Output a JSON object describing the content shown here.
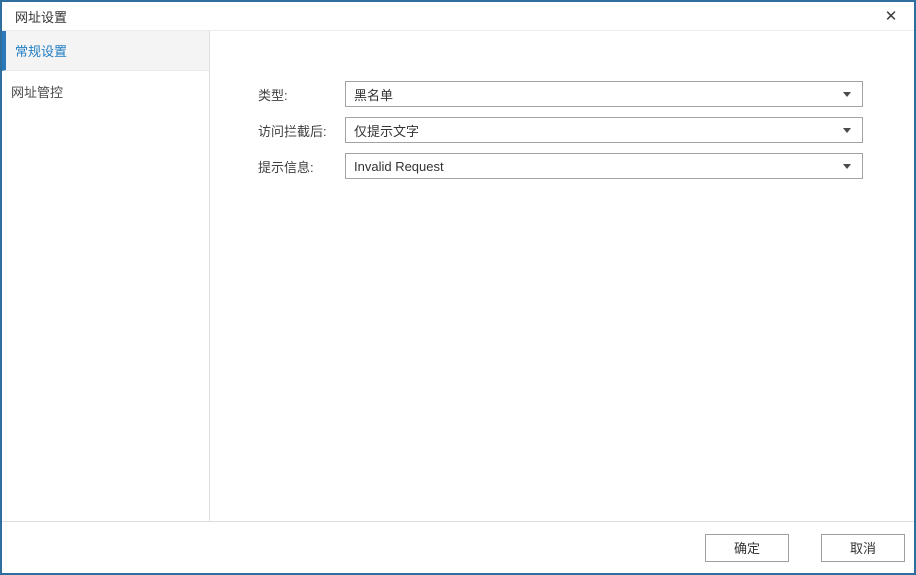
{
  "window": {
    "title": "网址设置",
    "close_icon": "✕"
  },
  "sidebar": {
    "items": [
      {
        "label": "常规设置",
        "selected": true
      },
      {
        "label": "网址管控",
        "selected": false
      }
    ]
  },
  "form": {
    "fields": [
      {
        "label": "类型:",
        "value": "黑名单"
      },
      {
        "label": "访问拦截后:",
        "value": "仅提示文字"
      },
      {
        "label": "提示信息:",
        "value": "Invalid Request"
      }
    ]
  },
  "footer": {
    "ok": "确定",
    "cancel": "取消"
  },
  "colors": {
    "dialog_border": "#2e6f9f",
    "selected_item_border": "#2a79bb",
    "selected_item_text": "#1f7dc4",
    "combobox_border": "#a3a3a3",
    "divider": "#dedede"
  }
}
